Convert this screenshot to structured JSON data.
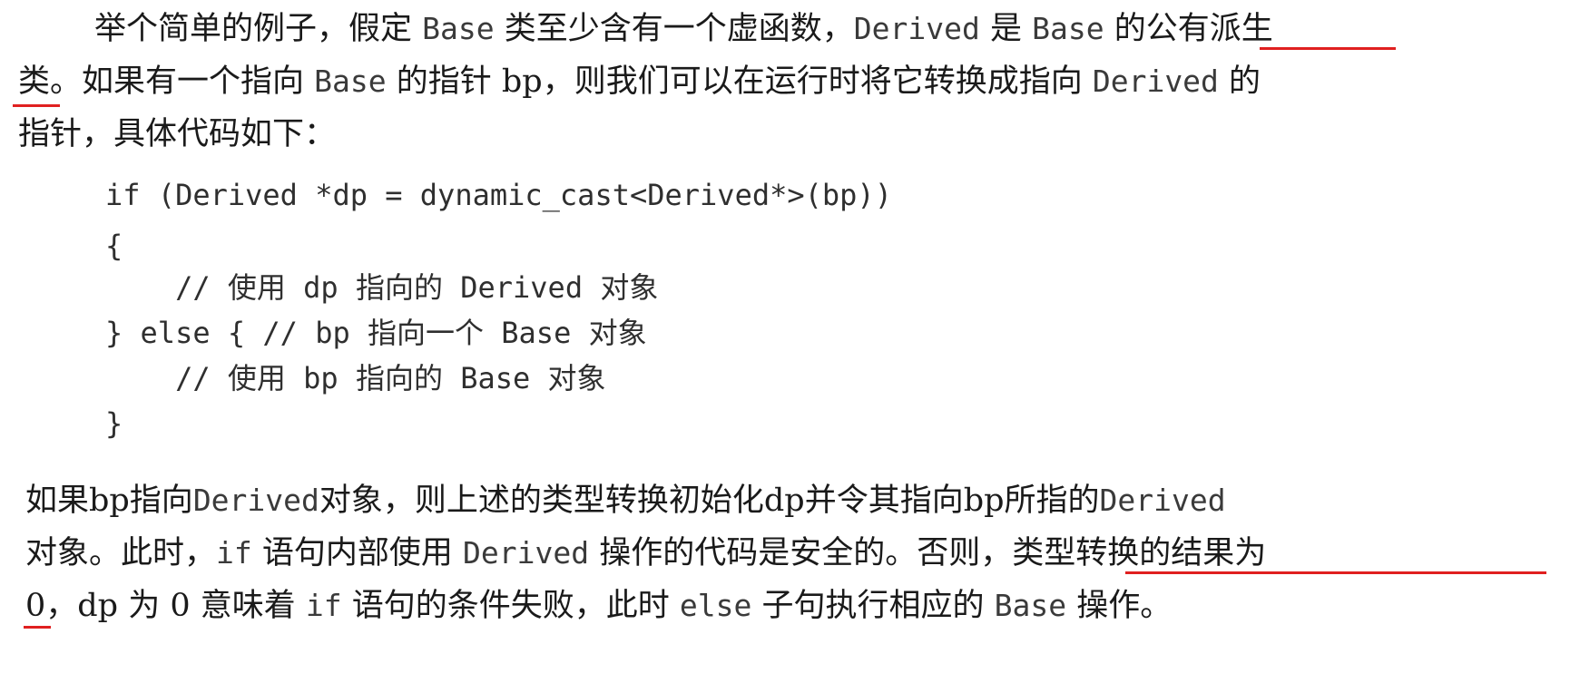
{
  "paragraph1": {
    "line1": [
      "举个简单的例子，假定 ",
      "Base",
      " 类至少含有一个虚函数，",
      "Derived",
      " 是 ",
      "Base",
      " 的",
      "公有派生"
    ],
    "line2": [
      "类",
      "。如果有一个指向 ",
      "Base",
      " 的指针 bp，则我们可以在运行时将它转换成指向 ",
      "Derived",
      " 的"
    ],
    "line3": [
      "指针，具体代码如下："
    ]
  },
  "code": {
    "line1": "if (Derived *dp = dynamic_cast<Derived*>(bp))",
    "line2": "{",
    "line3": [
      "    // ",
      "使用",
      " dp ",
      "指向的",
      " Derived ",
      "对象"
    ],
    "line4": [
      "} else { // bp ",
      "指向一个",
      " Base ",
      "对象"
    ],
    "line5": [
      "    // ",
      "使用",
      " bp ",
      "指向的",
      " Base ",
      "对象"
    ],
    "line6": "}"
  },
  "paragraph2": {
    "line1": [
      "如果bp指向",
      "Derived",
      "对象，则上述的类型转换初始化dp并令其指向bp所指的",
      "Derived"
    ],
    "line2": [
      "对象。此时，",
      "if",
      " 语句内部使用 ",
      "Derived",
      " 操作的代码是安全的。",
      "否则，类型转换的结果为"
    ],
    "line3": [
      "0",
      "，dp 为 0 意味着 ",
      "if",
      " 语句的条件失败，此时 ",
      "else",
      " 子句执行相应的 ",
      "Base",
      " 操作。"
    ]
  },
  "colors": {
    "text": "#1a1a1a",
    "underline": "#e02020"
  }
}
